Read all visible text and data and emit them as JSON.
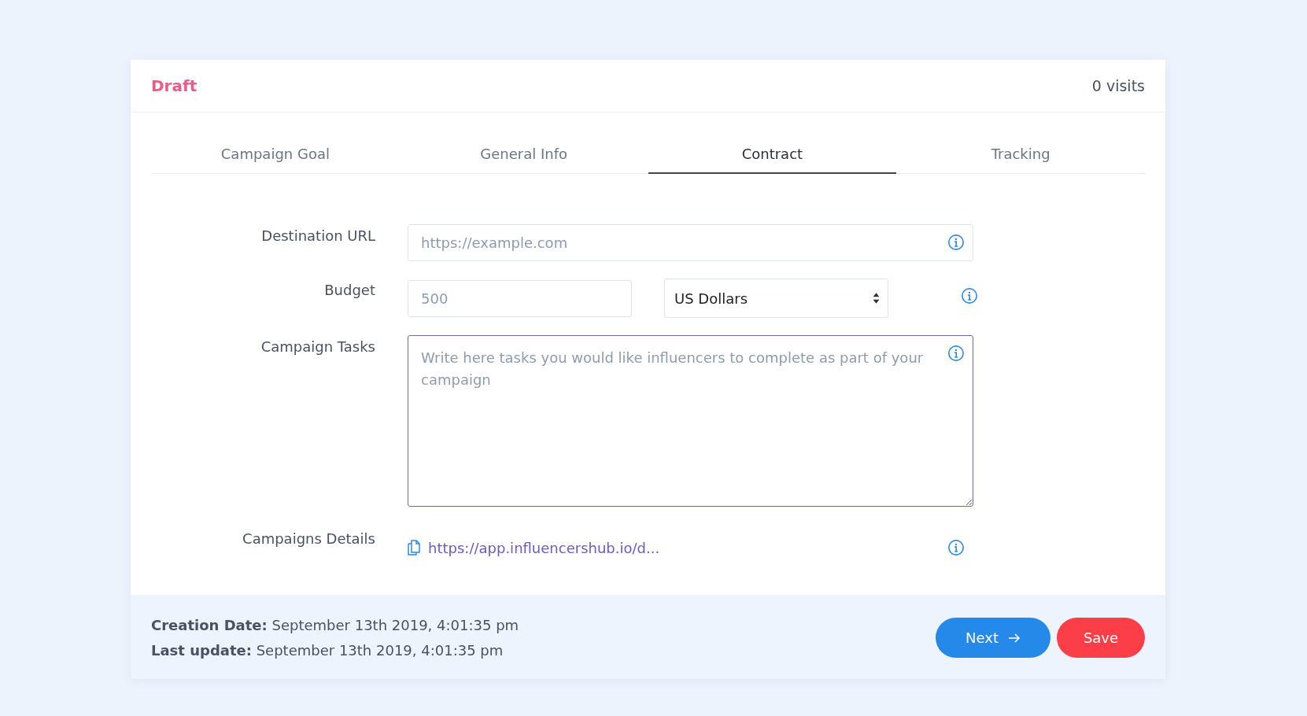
{
  "header": {
    "status": "Draft",
    "visits": "0 visits"
  },
  "tabs": [
    {
      "label": "Campaign Goal",
      "selected": false
    },
    {
      "label": "General Info",
      "selected": false
    },
    {
      "label": "Contract",
      "selected": true
    },
    {
      "label": "Tracking",
      "selected": false
    }
  ],
  "form": {
    "destination_url": {
      "label": "Destination URL",
      "placeholder": "https://example.com"
    },
    "budget": {
      "label": "Budget",
      "placeholder": "500",
      "currency": "US Dollars"
    },
    "campaign_tasks": {
      "label": "Campaign Tasks",
      "placeholder": "Write here tasks you would like influencers to complete as part of your campaign",
      "focused": true
    },
    "campaigns_details": {
      "label": "Campaigns Details",
      "link": "https://app.influencershub.io/d..."
    }
  },
  "footer": {
    "creation": {
      "label": "Creation Date:",
      "value": "September 13th 2019, 4:01:35 pm"
    },
    "update": {
      "label": "Last update:",
      "value": "September 13th 2019, 4:01:35 pm"
    },
    "buttons": [
      {
        "label": "Next",
        "kind": "next"
      },
      {
        "label": "Save",
        "kind": "save"
      }
    ]
  }
}
